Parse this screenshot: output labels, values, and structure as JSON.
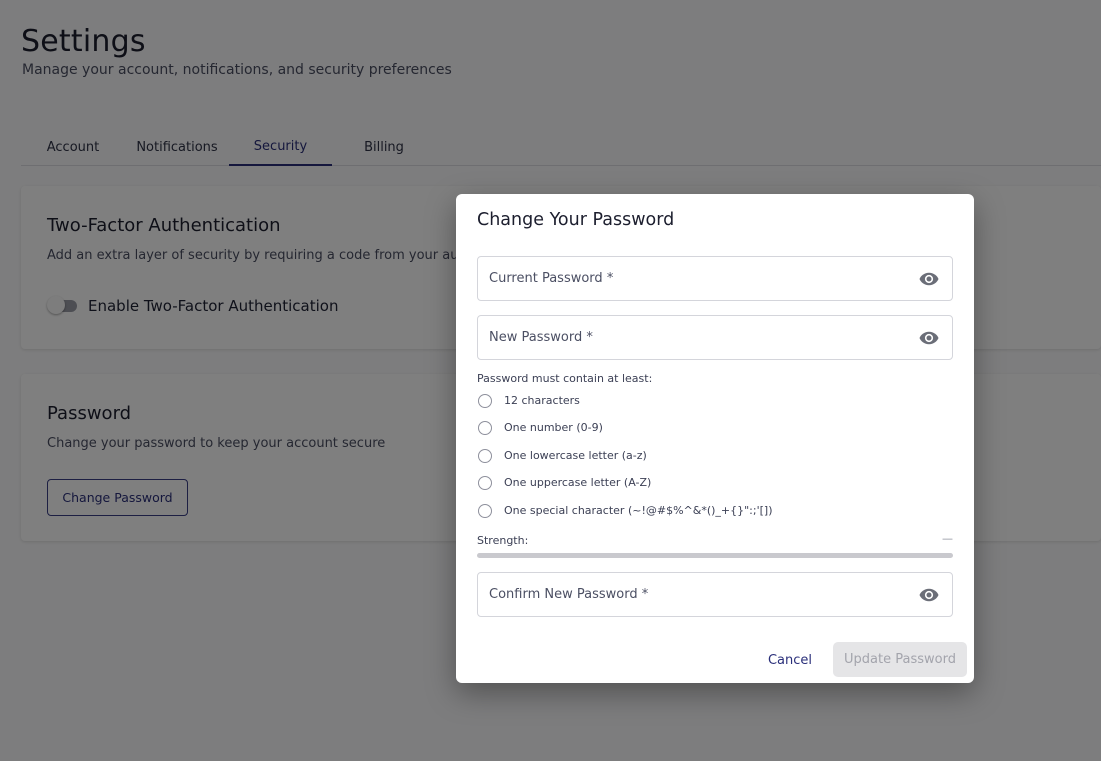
{
  "page": {
    "title": "Settings",
    "subtitle": "Manage your account, notifications, and security preferences"
  },
  "tabs": [
    {
      "label": "Account",
      "active": false
    },
    {
      "label": "Notifications",
      "active": false
    },
    {
      "label": "Security",
      "active": true
    },
    {
      "label": "Billing",
      "active": false
    }
  ],
  "two_factor": {
    "title": "Two-Factor Authentication",
    "description": "Add an extra layer of security by requiring a code from your authentic",
    "toggle_label": "Enable Two-Factor Authentication",
    "enabled": false
  },
  "password_card": {
    "title": "Password",
    "description": "Change your password to keep your account secure",
    "button_label": "Change Password"
  },
  "modal": {
    "title": "Change Your Password",
    "current_password_label": "Current Password *",
    "new_password_label": "New Password *",
    "confirm_password_label": "Confirm New Password *",
    "requirements_title": "Password must contain at least:",
    "requirements": [
      "12 characters",
      "One number (0-9)",
      "One lowercase letter (a-z)",
      "One uppercase letter (A-Z)",
      "One special character (~!@#$%^&*()_+{}\":;'[])"
    ],
    "strength_label": "Strength:",
    "strength_value": "—",
    "strength_level": 0,
    "cancel_label": "Cancel",
    "update_label": "Update Password"
  },
  "icons": {
    "password_visibility": "eye-icon"
  },
  "colors": {
    "accent": "#2a2f7a",
    "backdrop": "rgba(0,0,0,0.5)",
    "disabled_button_bg": "#e5e5e7",
    "disabled_button_text": "#a3a4ac"
  }
}
